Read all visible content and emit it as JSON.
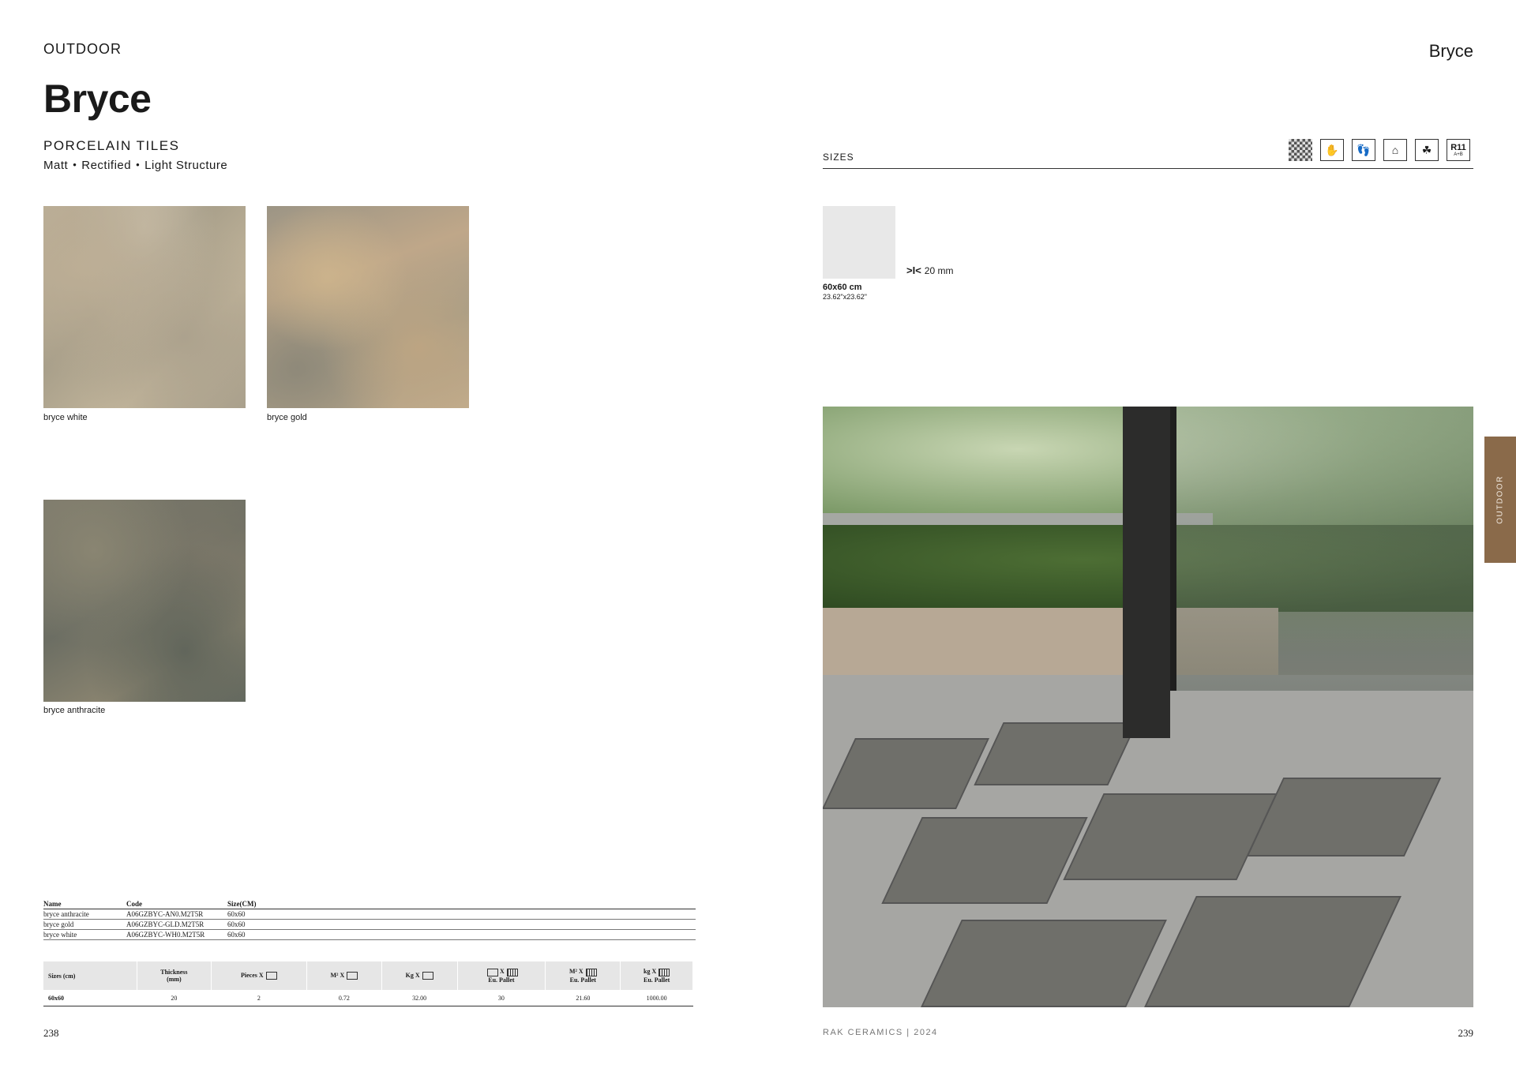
{
  "left": {
    "section": "OUTDOOR",
    "title": "Bryce",
    "subtitle": "PORCELAIN TILES",
    "finish": [
      "Matt",
      "Rectified",
      "Light Structure"
    ],
    "finish_sep": "•",
    "swatches": [
      {
        "label": "bryce white"
      },
      {
        "label": "bryce gold"
      },
      {
        "label": "bryce anthracite"
      }
    ],
    "codes_table": {
      "headers": [
        "Name",
        "Code",
        "Size(CM)"
      ],
      "rows": [
        [
          "bryce anthracite",
          "A06GZBYC-AN0.M2T5R",
          "60x60"
        ],
        [
          "bryce gold",
          "A06GZBYC-GLD.M2T5R",
          "60x60"
        ],
        [
          "bryce white",
          "A06GZBYC-WH0.M2T5R",
          "60x60"
        ]
      ]
    },
    "pack_table": {
      "headers": {
        "sizes": "Sizes (cm)",
        "thickness": "Thickness",
        "thickness_unit": "(mm)",
        "pieces": "Pieces",
        "m2": "M²",
        "kg": "Kg",
        "x": "X",
        "eu_pallet": "Eu. Pallet",
        "m2_short": "M²",
        "kg_short": "kg"
      },
      "row": [
        "60x60",
        "20",
        "2",
        "0.72",
        "32.00",
        "30",
        "21.60",
        "1000.00"
      ]
    },
    "page_number": "238"
  },
  "right": {
    "header": "Bryce",
    "sizes_label": "SIZES",
    "icons": [
      "color-variation-icon",
      "hand-icon",
      "footprints-icon",
      "house-icon",
      "outdoor-icon",
      "r11-icon"
    ],
    "r11": {
      "main": "R11",
      "sub": "A+B"
    },
    "size": {
      "name": "60x60 cm",
      "inches": "23.62\"x23.62\"",
      "thickness_symbol": ">I<",
      "thickness": "20 mm"
    },
    "side_tab": "OUTDOOR",
    "footer_brand": "RAK CERAMICS | 2024",
    "page_number": "239"
  }
}
